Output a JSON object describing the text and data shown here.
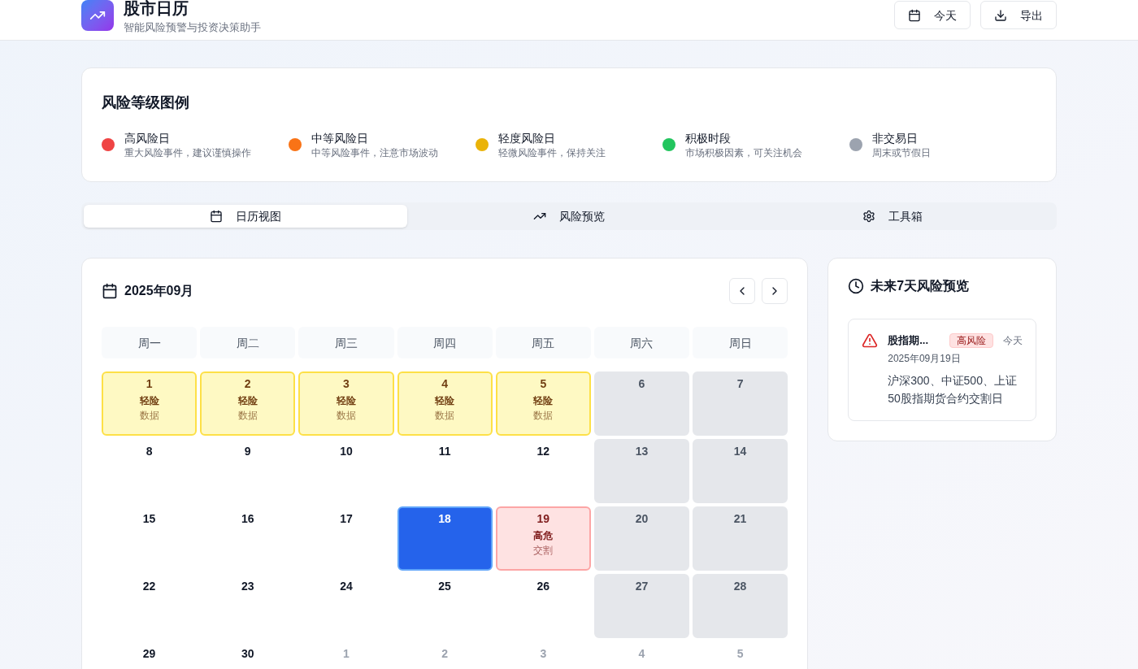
{
  "header": {
    "title": "股市日历",
    "subtitle": "智能风险预警与投资决策助手",
    "buttons": [
      {
        "kind": "today",
        "label": "今天"
      },
      {
        "kind": "export",
        "label": "导出"
      }
    ]
  },
  "legend": {
    "title": "风险等级图例",
    "items": [
      {
        "label": "高风险日",
        "description": "重大风险事件，建议谨慎操作",
        "color": "#ef4444"
      },
      {
        "label": "中等风险日",
        "description": "中等风险事件，注意市场波动",
        "color": "#f97316"
      },
      {
        "label": "轻度风险日",
        "description": "轻微风险事件，保持关注",
        "color": "#eab308"
      },
      {
        "label": "积极时段",
        "description": "市场积极因素，可关注机会",
        "color": "#22c55e"
      },
      {
        "label": "非交易日",
        "description": "周末或节假日",
        "color": "#9ca3af"
      }
    ]
  },
  "tabs": [
    {
      "kind": "calendar",
      "label": "日历视图",
      "selected": true
    },
    {
      "kind": "trend",
      "label": "风险预览",
      "selected": false
    },
    {
      "kind": "tools",
      "label": "工具箱",
      "selected": false
    }
  ],
  "calendar": {
    "month": "2025年09月",
    "weekdays": [
      "周一",
      "周二",
      "周三",
      "周四",
      "周五",
      "周六",
      "周日"
    ],
    "days": [
      {
        "day": "1",
        "kind": "light",
        "label": "轻险",
        "note": "数据"
      },
      {
        "day": "2",
        "kind": "light",
        "label": "轻险",
        "note": "数据"
      },
      {
        "day": "3",
        "kind": "light",
        "label": "轻险",
        "note": "数据"
      },
      {
        "day": "4",
        "kind": "light",
        "label": "轻险",
        "note": "数据"
      },
      {
        "day": "5",
        "kind": "light",
        "label": "轻险",
        "note": "数据"
      },
      {
        "day": "6",
        "kind": "closed"
      },
      {
        "day": "7",
        "kind": "closed"
      },
      {
        "day": "8",
        "kind": "normal"
      },
      {
        "day": "9",
        "kind": "normal"
      },
      {
        "day": "10",
        "kind": "normal"
      },
      {
        "day": "11",
        "kind": "normal"
      },
      {
        "day": "12",
        "kind": "normal"
      },
      {
        "day": "13",
        "kind": "closed"
      },
      {
        "day": "14",
        "kind": "closed"
      },
      {
        "day": "15",
        "kind": "normal"
      },
      {
        "day": "16",
        "kind": "normal"
      },
      {
        "day": "17",
        "kind": "normal"
      },
      {
        "day": "18",
        "kind": "today"
      },
      {
        "day": "19",
        "kind": "high",
        "label": "高危",
        "note": "交割"
      },
      {
        "day": "20",
        "kind": "closed"
      },
      {
        "day": "21",
        "kind": "closed"
      },
      {
        "day": "22",
        "kind": "normal"
      },
      {
        "day": "23",
        "kind": "normal"
      },
      {
        "day": "24",
        "kind": "normal"
      },
      {
        "day": "25",
        "kind": "normal"
      },
      {
        "day": "26",
        "kind": "normal"
      },
      {
        "day": "27",
        "kind": "closed"
      },
      {
        "day": "28",
        "kind": "closed"
      },
      {
        "day": "29",
        "kind": "normal"
      },
      {
        "day": "30",
        "kind": "normal"
      },
      {
        "day": "1",
        "kind": "outside"
      },
      {
        "day": "2",
        "kind": "outside"
      },
      {
        "day": "3",
        "kind": "outside"
      },
      {
        "day": "4",
        "kind": "outside"
      },
      {
        "day": "5",
        "kind": "outside"
      }
    ]
  },
  "preview": {
    "title": "未来7天风险预览",
    "events": [
      {
        "title": "股指期...",
        "badge": "高风险",
        "when": "今天",
        "date": "2025年09月19日",
        "description": "沪深300、中证500、上证50股指期货合约交割日"
      }
    ]
  }
}
